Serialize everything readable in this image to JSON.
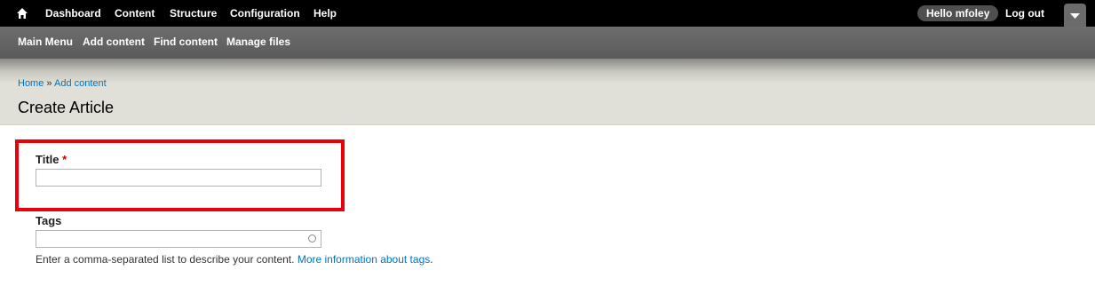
{
  "toolbar": {
    "home_icon": "home-icon",
    "menu": [
      "Dashboard",
      "Content",
      "Structure",
      "Configuration",
      "Help"
    ],
    "user_prefix": "Hello",
    "username": "mfoley",
    "logout": "Log out",
    "toggle_icon": "chevron-down-icon"
  },
  "shortcuts": [
    "Main Menu",
    "Add content",
    "Find content",
    "Manage files"
  ],
  "breadcrumb": {
    "items": [
      "Home",
      "Add content"
    ],
    "separator": "»"
  },
  "page": {
    "title": "Create Article"
  },
  "form": {
    "title_field": {
      "label": "Title",
      "required_mark": "*",
      "value": ""
    },
    "tags_field": {
      "label": "Tags",
      "value": "",
      "description": "Enter a comma-separated list to describe your content.",
      "help_link": "More information about tags"
    }
  },
  "colors": {
    "highlight": "#e8000b",
    "link": "#0074bd",
    "toolbar_bg": "#000000",
    "shortcut_bg": "#666666",
    "header_bg": "#e1e0d8"
  }
}
